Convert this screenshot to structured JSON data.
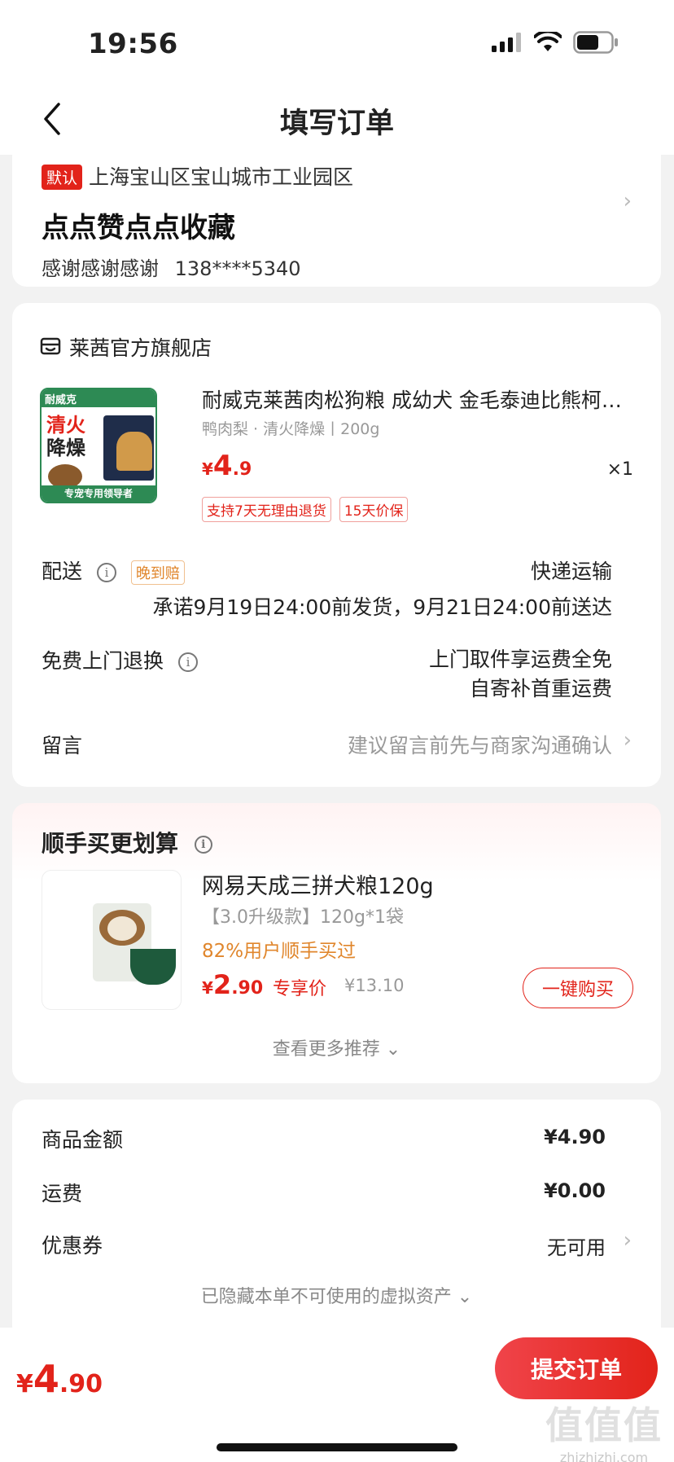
{
  "status_bar": {
    "time": "19:56"
  },
  "nav": {
    "title": "填写订单"
  },
  "address": {
    "default_tag": "默认",
    "line": "上海宝山区宝山城市工业园区",
    "name": "点点赞点点收藏",
    "contact_name": "感谢感谢感谢",
    "phone": "138****5340"
  },
  "store": {
    "name": "莱茜官方旗舰店",
    "product": {
      "title": "耐威克莱茜肉松狗粮 成幼犬 金毛泰迪比熊柯…",
      "spec": "鸭肉梨 · 清火降燥丨200g",
      "price_yen": "¥",
      "price_int": "4",
      "price_dec": ".9",
      "qty": "×1",
      "badges": [
        "支持7天无理由退货",
        "15天价保"
      ],
      "image_text": {
        "brand": "耐威克",
        "big1": "清火",
        "big2": "降燥",
        "footer": "专宠专用领导者"
      }
    },
    "delivery": {
      "label": "配送",
      "late_tag": "晚到赔",
      "method": "快递运输",
      "promise": "承诺9月19日24:00前发货，9月21日24:00前送达"
    },
    "return": {
      "label": "免费上门退换",
      "line1": "上门取件享运费全免",
      "line2": "自寄补首重运费"
    },
    "message": {
      "label": "留言",
      "placeholder": "建议留言前先与商家沟通确认"
    }
  },
  "recommend": {
    "title": "顺手买更划算",
    "item": {
      "name": "网易天成三拼犬粮120g",
      "spec": "【3.0升级款】120g*1袋",
      "pct": "82%用户顺手买过",
      "price_yen": "¥",
      "price_int": "2",
      "price_dec": ".90",
      "exclusive": "专享价",
      "orig": "¥13.10",
      "buy_label": "一键购买"
    },
    "more": "查看更多推荐 ⌄"
  },
  "summary": {
    "rows": [
      {
        "label": "商品金额",
        "value": "¥4.90"
      },
      {
        "label": "运费",
        "value": "¥0.00"
      },
      {
        "label": "优惠券",
        "value": "无可用"
      }
    ],
    "hidden_assets": "已隐藏本单不可使用的虚拟资产 ⌄"
  },
  "bottom": {
    "total_yen": "¥",
    "total_int": "4",
    "total_dec": ".90",
    "submit": "提交订单",
    "watermark_big": "值值值",
    "watermark_small": "zhizhizhi.com"
  },
  "colors": {
    "accent": "#e2231a",
    "orange": "#e0862c",
    "background": "#f2f2f2"
  }
}
